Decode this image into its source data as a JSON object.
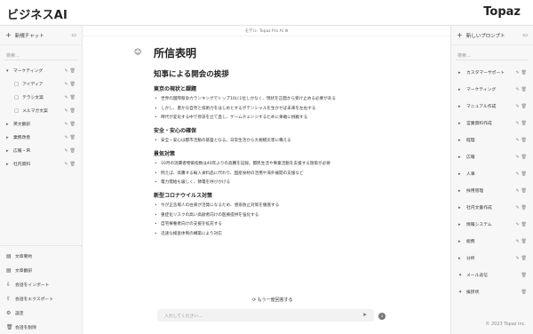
{
  "header": {
    "brand": "ビジネスAI",
    "logo": "Topaz"
  },
  "left_sidebar": {
    "new_chat": "新規チャット",
    "search_placeholder": "検索...",
    "tree": [
      {
        "label": "マーケティング",
        "type": "folder",
        "expanded": true
      },
      {
        "label": "アイディア",
        "type": "chat"
      },
      {
        "label": "テラシ文案",
        "type": "chat"
      },
      {
        "label": "メルマガ文案",
        "type": "chat"
      },
      {
        "label": "英文翻訳",
        "type": "folder"
      },
      {
        "label": "業務改善",
        "type": "folder"
      },
      {
        "label": "広報・IR",
        "type": "folder"
      },
      {
        "label": "社内資料",
        "type": "folder"
      }
    ],
    "bottom": [
      {
        "label": "文章要約",
        "icon": "document-icon"
      },
      {
        "label": "文章翻訳",
        "icon": "document-icon"
      },
      {
        "label": "会話をインポート",
        "icon": "import-icon"
      },
      {
        "label": "会話をエクスポート",
        "icon": "export-icon"
      },
      {
        "label": "設定",
        "icon": "gear-icon"
      },
      {
        "label": "会話を削除",
        "icon": "trash-icon"
      }
    ]
  },
  "right_sidebar": {
    "new_prompt": "新しいプロンプト",
    "search_placeholder": "検索...",
    "prompts": [
      "カスタマーサポート",
      "マーケティング",
      "マニュアル作成",
      "営業資料作成",
      "経理",
      "広報",
      "人事",
      "採用管理",
      "社内文書作成",
      "情報システム",
      "総務",
      "分析"
    ],
    "templates": [
      "メール返信",
      "挨拶状"
    ],
    "copyright": "© 2023 Topaz Inc."
  },
  "main": {
    "model_label": "モデル: Topaz Pro AI",
    "title": "所信表明",
    "subtitle": "知事による開会の挨拶",
    "sections": [
      {
        "heading": "東京の現状と課題",
        "items": [
          "世界の国際競争力ランキングでトップ10に1位しかなく、現状を正面から受け止める必要がある",
          "しかし、豊かな自然と技術力をはじめとするポテンシャルを生かせば未来を左右する",
          "時代が変化する中で停滞を立て直し、ゲームチェンジするために果敢に挑戦する"
        ]
      },
      {
        "heading": "安全・安心の確保",
        "items": [
          "安全・安心は都市活動の基盤となる。日常生活から大規模災害に備える"
        ]
      },
      {
        "heading": "景気対策",
        "items": [
          "10月の消費者物価指数は40年ぶりの高騰を記録。都民生活や事業活動を支援する施策が必要",
          "例えば、高騰する輸入食料品に代わり、国産食材の活用や海外展開の支援など",
          "電力需給も厳しく、節電を呼びかける"
        ]
      },
      {
        "heading": "新型コロナウイルス対策",
        "items": [
          "今が正念場人の往来が活発になるため、感染防止対策を徹底する",
          "重症化リスクの高い高齢者向けの医療提供を強化する",
          "自宅療養者向けの支援を拡充する",
          "迅速な検査体制の構築により対応"
        ]
      }
    ],
    "regenerate": "もう一度回答する",
    "input_placeholder": "入力してください..."
  }
}
